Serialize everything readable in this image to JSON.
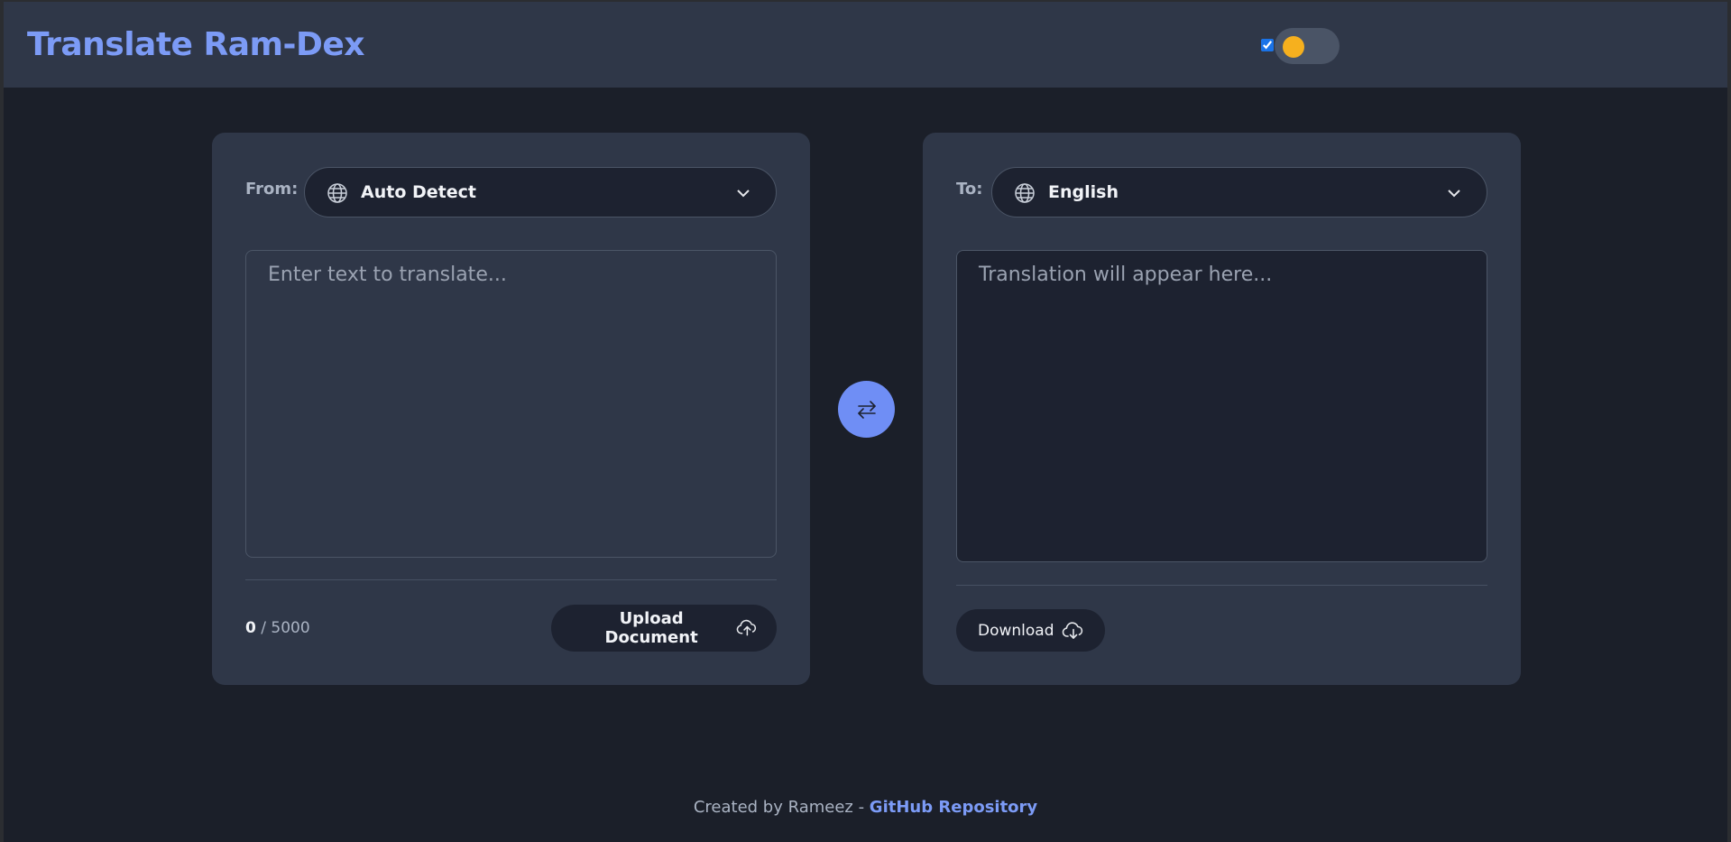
{
  "header": {
    "title": "Translate Ram-Dex",
    "theme_toggle_checked": true
  },
  "source": {
    "label": "From:",
    "language": "Auto Detect",
    "placeholder": "Enter text to translate...",
    "char_count": "0",
    "char_separator": "/",
    "char_limit": "5000",
    "upload_label": "Upload Document"
  },
  "target": {
    "label": "To:",
    "language": "English",
    "placeholder": "Translation will appear here...",
    "download_label": "Download"
  },
  "footer": {
    "credit_text": "Created by Rameez - ",
    "link_text": "GitHub Repository"
  },
  "colors": {
    "accent": "#7c9bf6",
    "swap_button": "#6f8ef5",
    "toggle_knob": "#f6b01e",
    "panel": "#2f3748",
    "background": "#1b1f29"
  },
  "icons": {
    "language_select": "globe-icon",
    "dropdown": "chevron-down-icon",
    "swap": "swap-arrows-icon",
    "upload": "cloud-upload-icon",
    "download": "cloud-download-icon"
  }
}
